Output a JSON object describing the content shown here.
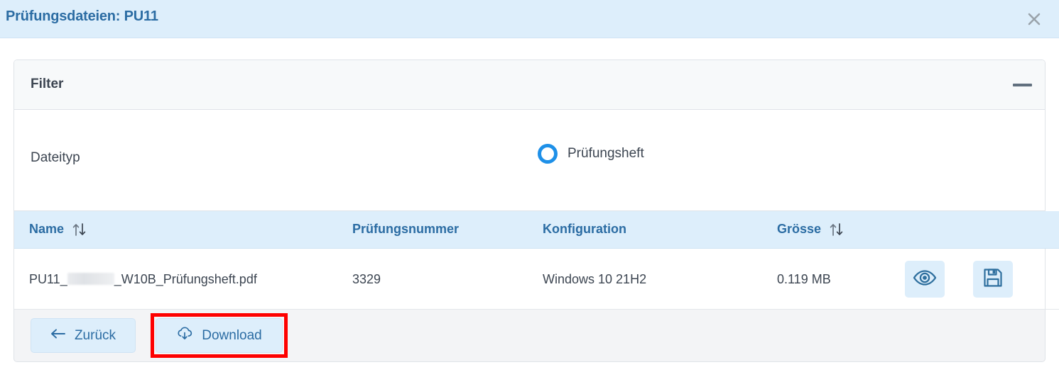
{
  "header": {
    "title": "Prüfungsdateien: PU11",
    "close_icon": "close-icon"
  },
  "filter_panel": {
    "title": "Filter",
    "collapse_icon": "minus-icon",
    "dateityp": {
      "label": "Dateityp",
      "options": [
        {
          "label": "Prüfungsheft",
          "selected": true
        }
      ]
    }
  },
  "table": {
    "columns": [
      {
        "label": "Name",
        "sortable": true
      },
      {
        "label": "Prüfungsnummer",
        "sortable": false
      },
      {
        "label": "Konfiguration",
        "sortable": false
      },
      {
        "label": "Grösse",
        "sortable": true
      },
      {
        "label": "",
        "sortable": false
      }
    ],
    "rows": [
      {
        "name_prefix": "PU11_",
        "name_redacted": true,
        "name_suffix": "_W10B_Prüfungsheft.pdf",
        "pruefungsnummer": "3329",
        "konfiguration": "Windows 10 21H2",
        "groesse": "0.119 MB",
        "actions": [
          {
            "icon": "eye-icon",
            "title": "Vorschau"
          },
          {
            "icon": "save-icon",
            "title": "Speichern"
          }
        ]
      }
    ]
  },
  "footer": {
    "back_label": "Zurück",
    "back_icon": "arrow-left-icon",
    "download_label": "Download",
    "download_icon": "cloud-download-icon",
    "highlight_target": "download-button"
  },
  "colors": {
    "header_bg": "#ddeefb",
    "title_blue": "#2b6ca3",
    "radio_blue": "#1e90e8",
    "icon_blue": "#2e6f9e",
    "highlight_red": "#fe0000",
    "footer_bg": "#f3f4f6",
    "panel_bg": "#f7f9fa"
  }
}
